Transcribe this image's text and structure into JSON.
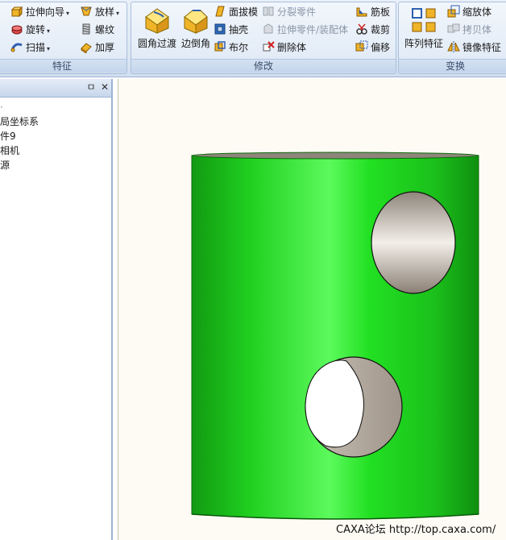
{
  "ribbon": {
    "features": {
      "label": "特征",
      "extrude_wizard": "拉伸向导",
      "revolve": "旋转",
      "sweep": "扫描",
      "loft": "放样",
      "thread": "螺纹",
      "thicken": "加厚"
    },
    "modify": {
      "label": "修改",
      "fillet": "圆角过渡",
      "chamfer": "边倒角",
      "face_draft": "面拔模",
      "shell": "抽壳",
      "boolean": "布尔",
      "split_part": "分裂零件",
      "extrude_part_assembly": "拉伸零件/装配体",
      "delete_body": "删除体",
      "rib": "筋板",
      "trim": "裁剪",
      "offset": "偏移"
    },
    "transform": {
      "label": "变换",
      "pattern": "阵列特征",
      "scale_body": "缩放体",
      "copy_body": "拷贝体",
      "mirror_feature": "镜像特征"
    }
  },
  "panel": {
    "pin_glyph": "ㅁ",
    "close_glyph": "✕",
    "tree_items": [
      "局坐标系",
      "件9",
      "相机",
      "源"
    ]
  },
  "viewport": {
    "part_color": "#22d822",
    "hole_color": "#b8aea2",
    "background": "#fdfbf3",
    "watermark": "CAXA论坛 http://top.caxa.com/"
  }
}
